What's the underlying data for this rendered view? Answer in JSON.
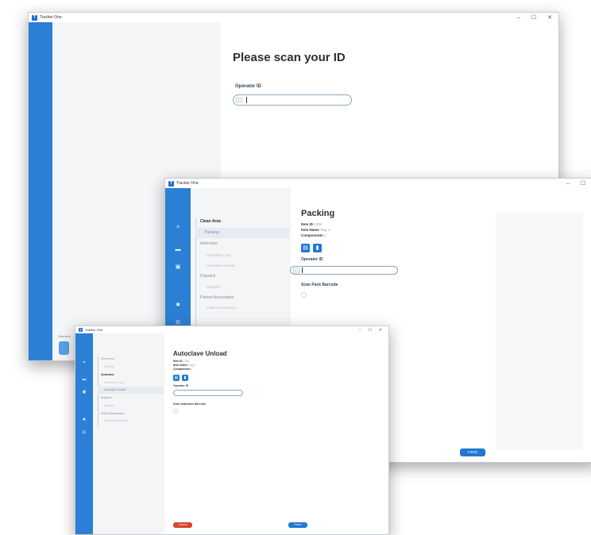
{
  "app": {
    "title": "Tracker One",
    "icon_label": "T"
  },
  "window_controls": {
    "minimize": "–",
    "maximize": "☐",
    "close": "✕"
  },
  "scan_window": {
    "heading": "Please scan your ID",
    "operator_label": "Operator ID",
    "operator_prefix": "ID",
    "user_label": "Operator"
  },
  "packing_window": {
    "nav": {
      "clean_area": "Clean Area",
      "packing": "Packing",
      "autoclave": "Autoclave",
      "autoclave_load": "Autoclave Load",
      "autoclave_unload": "Autoclave Unload",
      "dispatch": "Dispatch",
      "dispatch_sub": "Dispatch",
      "patient_association": "Patient Association",
      "patient_association_sub": "Patient Association"
    },
    "heading": "Packing",
    "item_id_label": "Item ID",
    "item_id_value": "1234",
    "item_name_label": "Item Name",
    "item_name_value": "Tray 1",
    "components_label": "Components",
    "components_value": "1",
    "operator_label": "Operator ID",
    "operator_prefix": "ID",
    "scan_pack_label": "Scan Pack Barcode",
    "finish_button": "Finish"
  },
  "unload_window": {
    "nav": {
      "clean_area": "Clean Area",
      "packing": "Packing",
      "autoclave": "Autoclave",
      "autoclave_load": "Autoclave Load",
      "autoclave_unload": "Autoclave Unload",
      "dispatch": "Dispatch",
      "dispatch_sub": "Dispatch",
      "patient_association": "Patient Association",
      "patient_association_sub": "Patient Association"
    },
    "heading": "Autoclave Unload",
    "item_id_label": "Item ID",
    "item_id_value": "1234",
    "item_name_label": "Item Name",
    "item_name_value": "Tray 1",
    "components_label": "Components",
    "components_value": "1",
    "operator_label": "Operator ID",
    "scan_label": "Scan Autoclave Barcode",
    "cancel_button": "Cancel",
    "finish_button": "Finish"
  },
  "colors": {
    "accent": "#1f78d1",
    "rail": "#2b7fd4",
    "danger": "#d8432c"
  }
}
